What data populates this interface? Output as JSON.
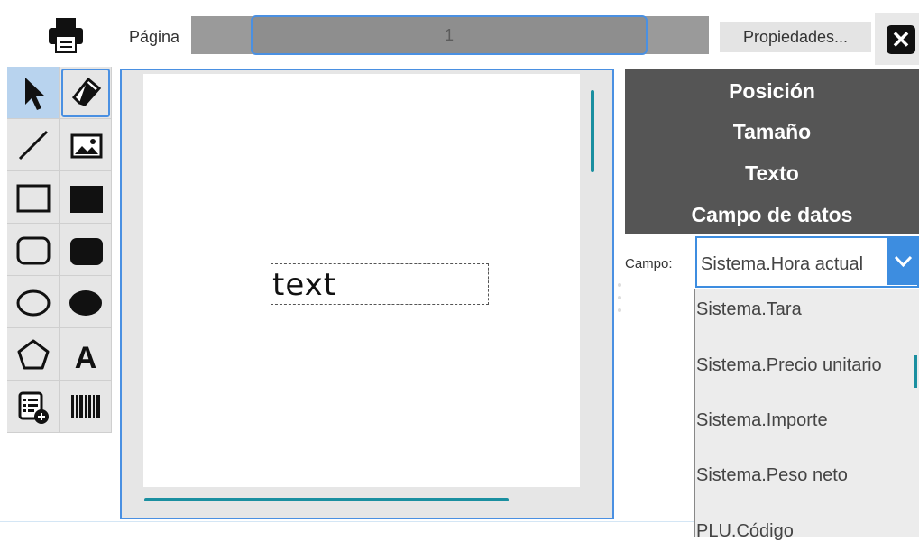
{
  "toolbar": {
    "page_label": "Página",
    "page_value": "1",
    "properties_label": "Propiedades...",
    "close_glyph": "✕"
  },
  "tools": [
    {
      "name": "pointer-icon",
      "selected": true
    },
    {
      "name": "eraser-icon",
      "outlined": true
    },
    {
      "name": "line-icon"
    },
    {
      "name": "image-icon"
    },
    {
      "name": "rectangle-icon"
    },
    {
      "name": "filled-rectangle-icon"
    },
    {
      "name": "rounded-rectangle-icon"
    },
    {
      "name": "filled-rounded-rectangle-icon"
    },
    {
      "name": "ellipse-icon"
    },
    {
      "name": "filled-ellipse-icon"
    },
    {
      "name": "polygon-icon"
    },
    {
      "name": "text-icon",
      "glyph": "A"
    },
    {
      "name": "data-field-icon"
    },
    {
      "name": "barcode-icon"
    }
  ],
  "canvas": {
    "text_object": "text"
  },
  "properties": {
    "sections": [
      "Posición",
      "Tamaño",
      "Texto",
      "Campo de datos"
    ],
    "field_label": "Campo:",
    "field_value": "Sistema.Hora actual",
    "options": [
      "Sistema.Tara",
      "Sistema.Precio unitario",
      "Sistema.Importe",
      "Sistema.Peso neto",
      "PLU.Código"
    ]
  },
  "colors": {
    "accent": "#4a90e2",
    "scrollbar": "#1a8fa0",
    "panel": "#555555"
  }
}
